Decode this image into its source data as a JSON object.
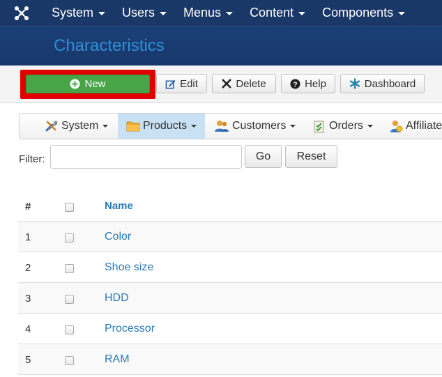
{
  "topnav": {
    "logo": "joomla-logo-icon",
    "items": [
      {
        "label": "System"
      },
      {
        "label": "Users"
      },
      {
        "label": "Menus"
      },
      {
        "label": "Content"
      },
      {
        "label": "Components"
      }
    ]
  },
  "header": {
    "title": "Characteristics"
  },
  "toolbar": {
    "new_label": "New",
    "edit_label": "Edit",
    "delete_label": "Delete",
    "help_label": "Help",
    "dashboard_label": "Dashboard"
  },
  "submenu": {
    "items": [
      {
        "label": "System",
        "icon": "tools-icon"
      },
      {
        "label": "Products",
        "icon": "folder-icon",
        "active": true
      },
      {
        "label": "Customers",
        "icon": "users-icon"
      },
      {
        "label": "Orders",
        "icon": "clipboard-icon"
      },
      {
        "label": "Affiliate",
        "icon": "affiliate-icon"
      }
    ]
  },
  "filter": {
    "label": "Filter:",
    "value": "",
    "go_label": "Go",
    "reset_label": "Reset"
  },
  "table": {
    "headers": {
      "num": "#",
      "name": "Name"
    },
    "rows": [
      {
        "num": "1",
        "name": "Color"
      },
      {
        "num": "2",
        "name": "Shoe size"
      },
      {
        "num": "3",
        "name": "HDD"
      },
      {
        "num": "4",
        "name": "Processor"
      },
      {
        "num": "5",
        "name": "RAM"
      }
    ]
  },
  "colors": {
    "nav_bg": "#1a3867",
    "header_title": "#2f8fd6",
    "new_button": "#47a447",
    "highlight": "#e00000",
    "link": "#2a7ab8",
    "active_submenu": "#c8e1f5"
  }
}
